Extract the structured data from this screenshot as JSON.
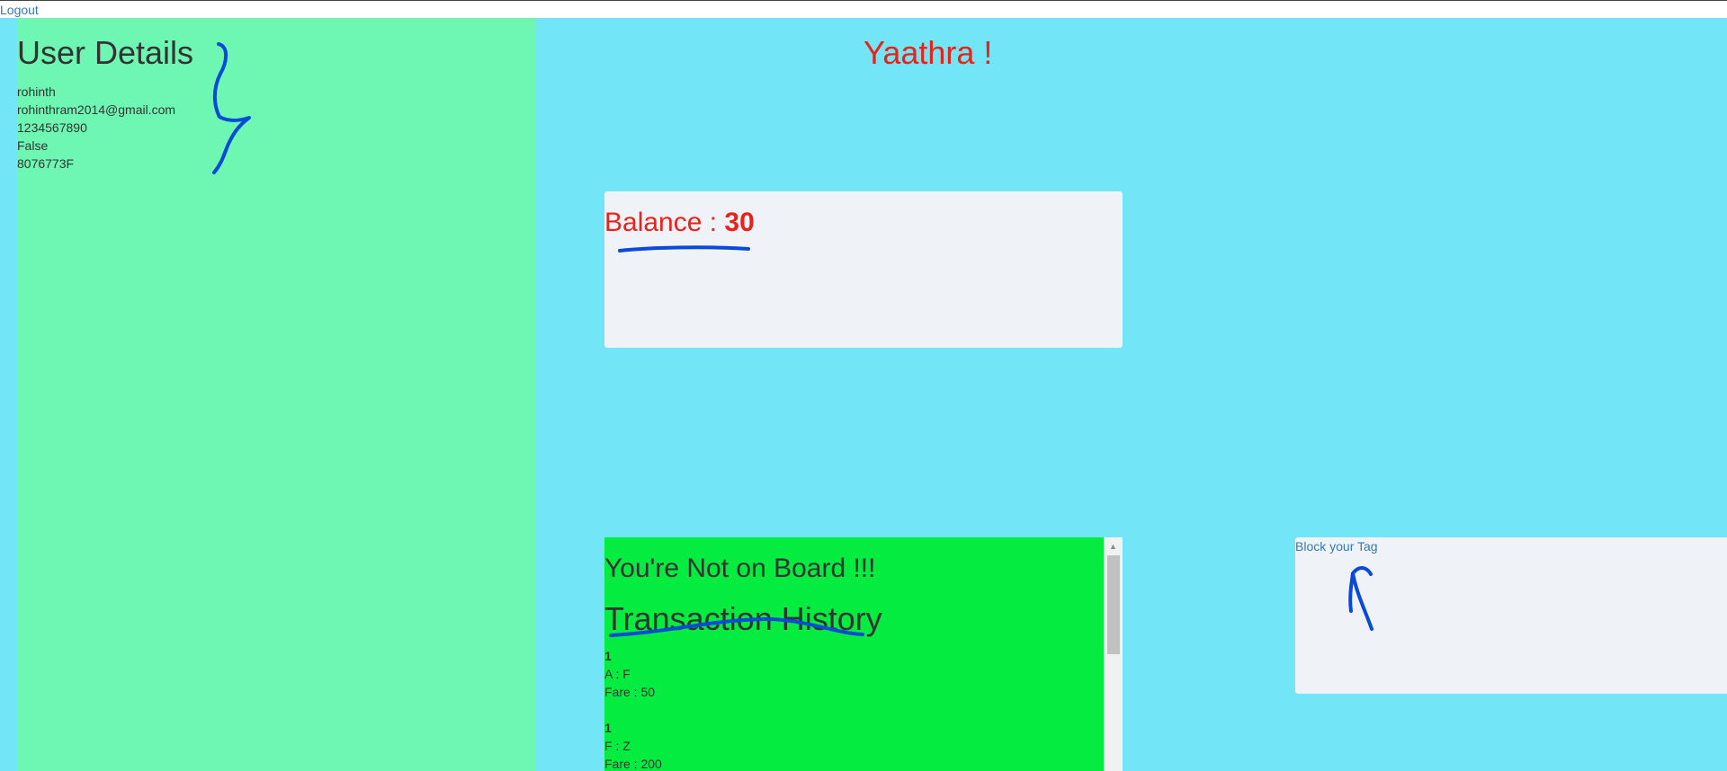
{
  "header": {
    "logout_label": "Logout"
  },
  "user_panel": {
    "title": "User Details",
    "name": "rohinth",
    "email": "rohinthram2014@gmail.com",
    "phone": "1234567890",
    "on_board_flag": "False",
    "tag_id": "8076773F"
  },
  "app": {
    "title": "Yaathra !"
  },
  "balance": {
    "label": "Balance : ",
    "value": "30"
  },
  "history": {
    "status": "You're Not on Board !!!",
    "title": "Transaction History",
    "transactions": [
      {
        "id": "1",
        "route": "A : F",
        "fare": "Fare : 50"
      },
      {
        "id": "1",
        "route": "F : Z",
        "fare": "Fare : 200"
      }
    ]
  },
  "block": {
    "label": "Block your Tag"
  },
  "colors": {
    "page_background": "#72e6f6",
    "user_panel_background": "#6ef6b3",
    "history_background": "#04ec3f",
    "card_background": "#eff3f7",
    "accent_red": "#e8231c",
    "link_blue": "#337ab7",
    "annotation_blue": "#0a4ad8"
  }
}
